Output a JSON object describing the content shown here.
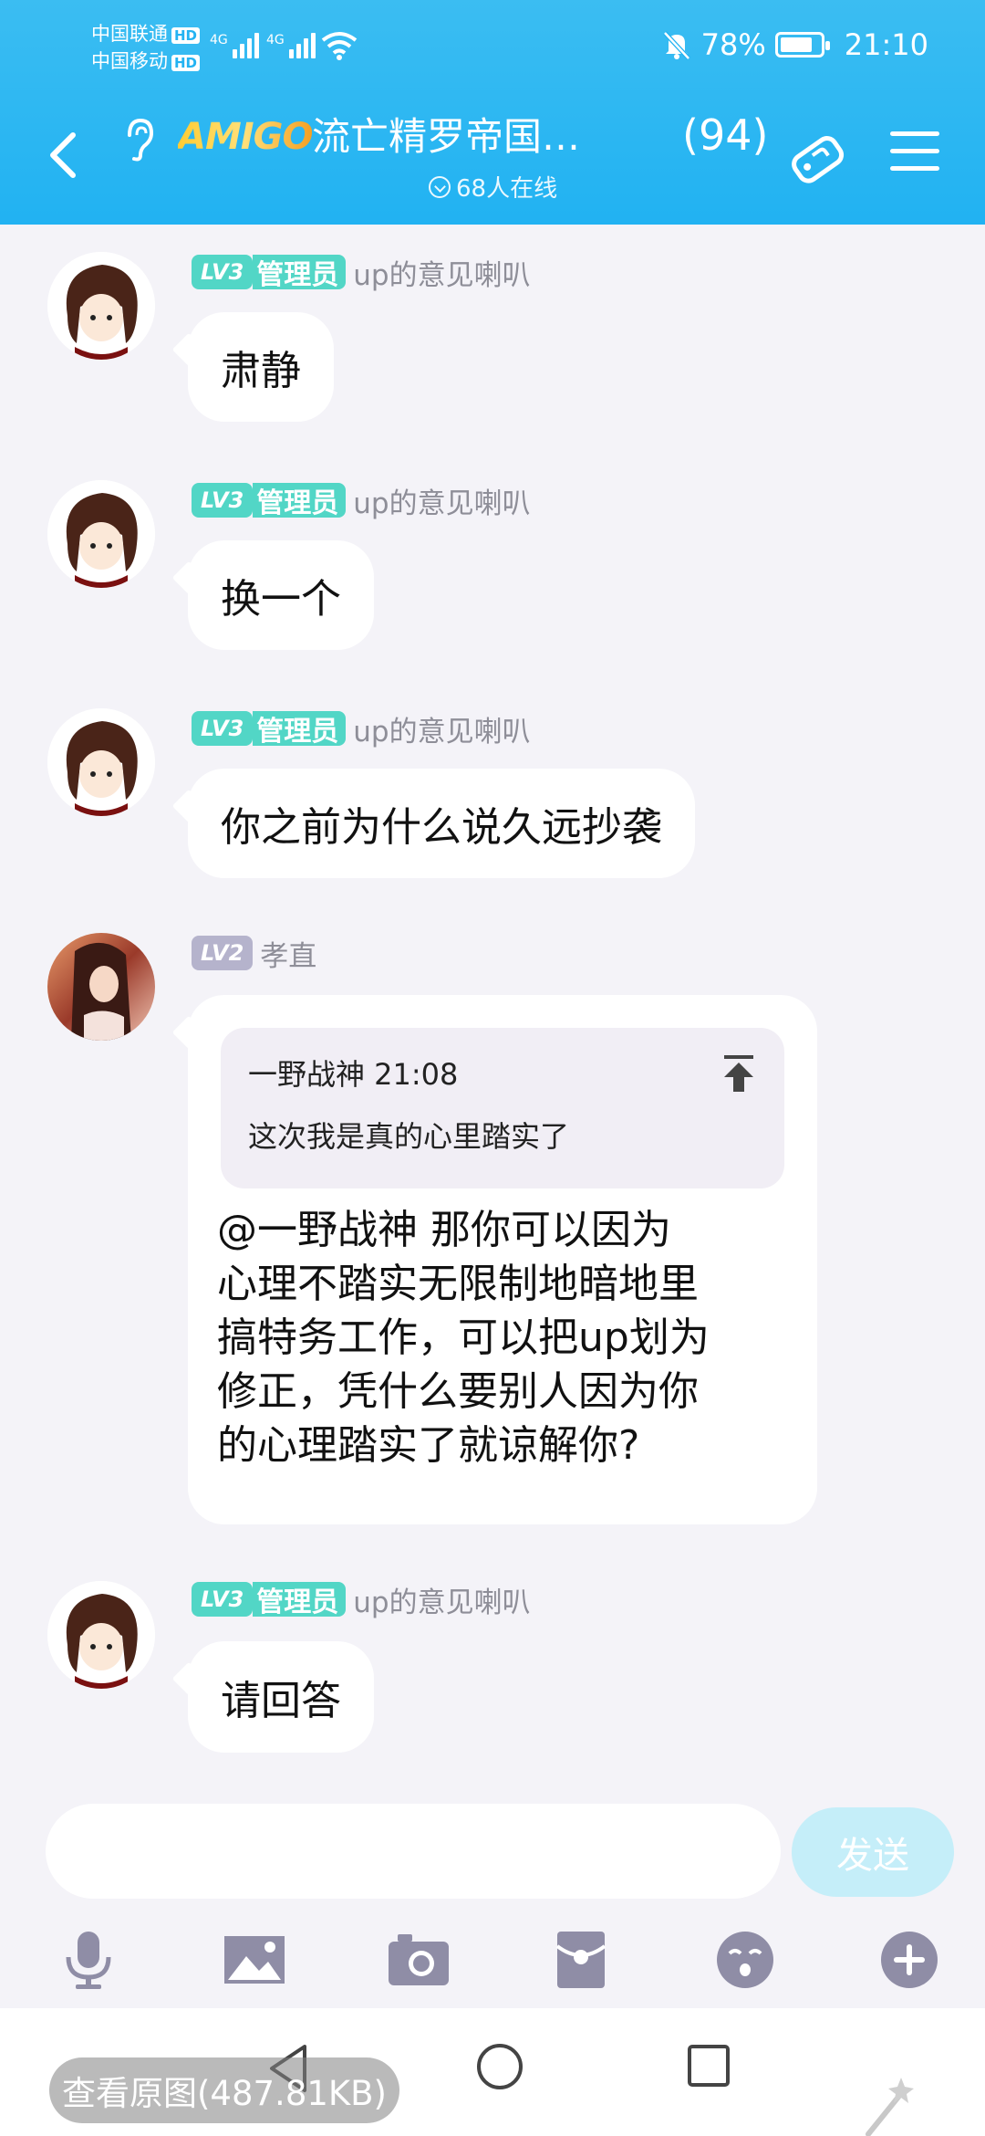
{
  "status_bar": {
    "carrier1": "中国联通",
    "carrier2": "中国移动",
    "hd": "HD",
    "net1": "4G",
    "net2": "4G",
    "battery": "78%",
    "time": "21:10"
  },
  "header": {
    "logo": "AMIGO",
    "title": "流亡精罗帝国…",
    "count": "(94)",
    "online": "68人在线"
  },
  "messages": [
    {
      "level": "LV3",
      "role": "管理员",
      "nick": "up的意见喇叭",
      "text": "肃静"
    },
    {
      "level": "LV3",
      "role": "管理员",
      "nick": "up的意见喇叭",
      "text": "换一个"
    },
    {
      "level": "LV3",
      "role": "管理员",
      "nick": "up的意见喇叭",
      "text": "你之前为什么说久远抄袭"
    },
    {
      "level": "LV2",
      "nick": "孝直",
      "quote_head": "一野战神 21:08",
      "quote_body": "这次我是真的心里踏实了",
      "lines": [
        "@一野战神 那你可以因为",
        "心理不踏实无限制地暗地里",
        "搞特务工作，可以把up划为",
        "修正，凭什么要别人因为你",
        "的心理踏实了就谅解你?"
      ]
    },
    {
      "level": "LV3",
      "role": "管理员",
      "nick": "up的意见喇叭",
      "text": "请回答"
    }
  ],
  "input": {
    "send_label": "发送"
  },
  "toolbar": [
    "microphone-icon",
    "image-icon",
    "camera-icon",
    "red-packet-icon",
    "emoji-icon",
    "plus-icon"
  ],
  "view_original": "查看原图(487.81KB)",
  "colors": {
    "header": "#22b2f2",
    "level_teal": "#52d6c6",
    "level_gray": "#b5b3cc",
    "send_disabled": "#c5eef9"
  }
}
